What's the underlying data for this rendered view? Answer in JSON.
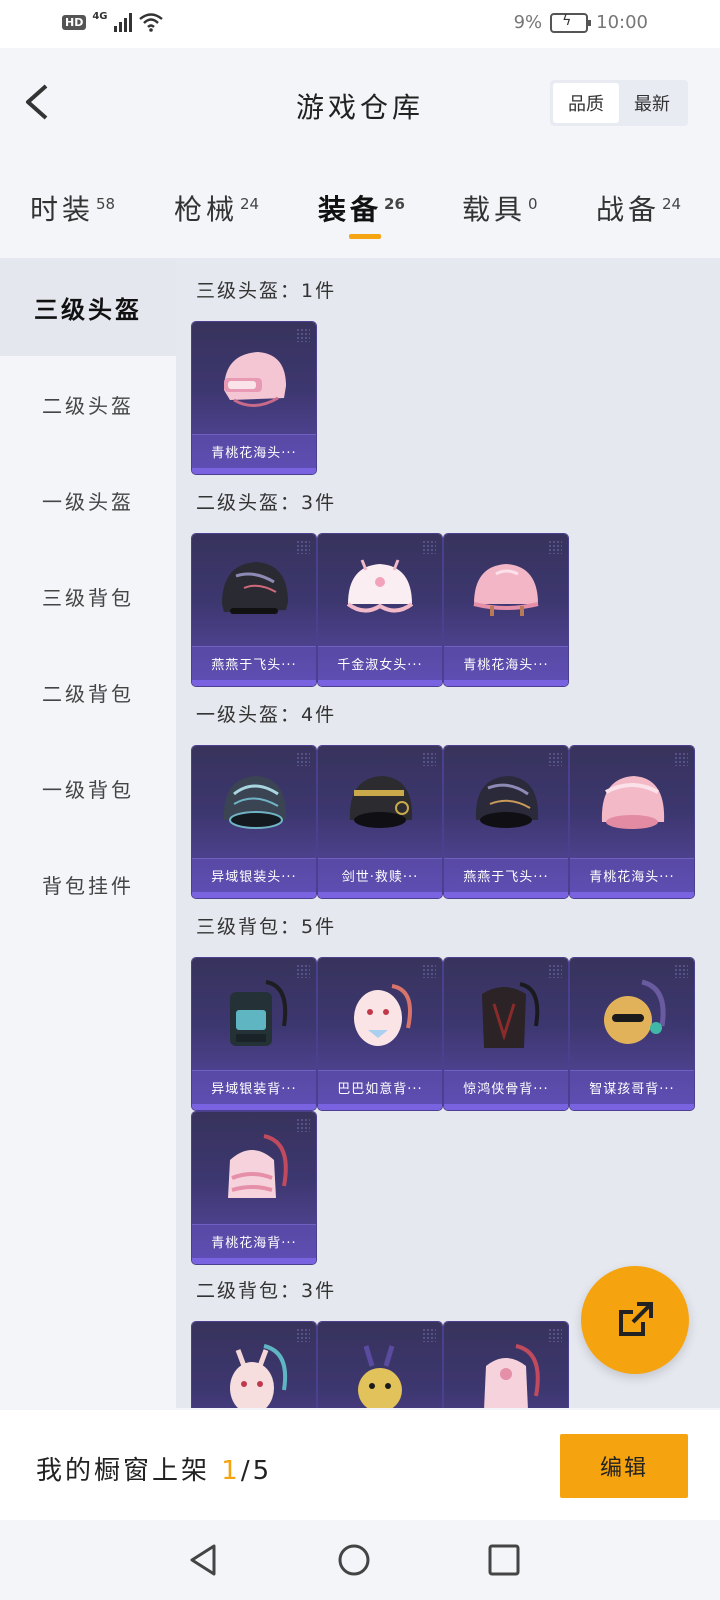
{
  "status": {
    "hd": "HD",
    "network": "4G",
    "battery": "9%",
    "time": "10:00"
  },
  "header": {
    "title": "游戏仓库",
    "sort_options": [
      "品质",
      "最新"
    ],
    "sort_active": "品质"
  },
  "tabs": [
    {
      "label": "时装",
      "count": "58"
    },
    {
      "label": "枪械",
      "count": "24"
    },
    {
      "label": "装备",
      "count": "26",
      "active": true
    },
    {
      "label": "载具",
      "count": "0"
    },
    {
      "label": "战备",
      "count": "24"
    }
  ],
  "sidebar": {
    "items": [
      "三级头盔",
      "二级头盔",
      "一级头盔",
      "三级背包",
      "二级背包",
      "一级背包",
      "背包挂件"
    ],
    "active": "三级头盔"
  },
  "sections": [
    {
      "title": "三级头盔：1件",
      "items": [
        "青桃花海头···"
      ]
    },
    {
      "title": "二级头盔：3件",
      "items": [
        "燕燕于飞头···",
        "千金淑女头···",
        "青桃花海头···"
      ]
    },
    {
      "title": "一级头盔：4件",
      "items": [
        "异域银装头···",
        "剑世·救赎···",
        "燕燕于飞头···",
        "青桃花海头···"
      ]
    },
    {
      "title": "三级背包：5件",
      "items": [
        "异域银装背···",
        "巴巴如意背···",
        "惊鸿侠骨背···",
        "智谋孩哥背···",
        "青桃花海背···"
      ]
    },
    {
      "title": "二级背包：3件",
      "items": [
        "",
        "",
        ""
      ]
    }
  ],
  "bottom": {
    "showcase_label": "我的橱窗上架",
    "showcase_current": "1",
    "showcase_total": "/5",
    "edit_label": "编辑"
  },
  "colors": {
    "accent": "#f5a30f",
    "card_top": "#37335c",
    "card_bottom": "#5a4aa6"
  }
}
